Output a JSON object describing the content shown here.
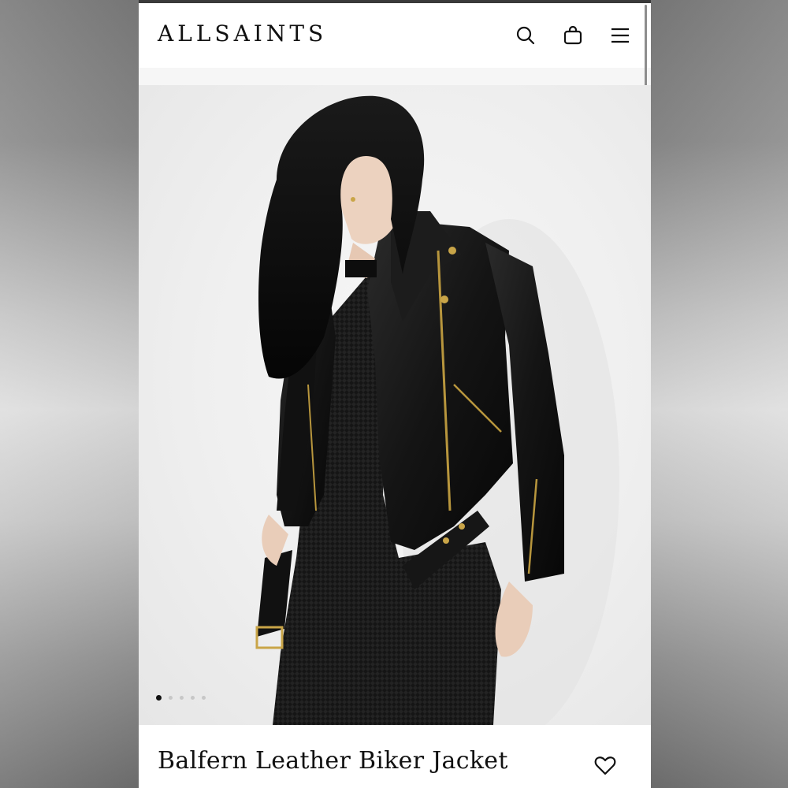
{
  "brand": {
    "logo_text": "ALLSAINTS"
  },
  "header": {
    "icons": [
      "search-icon",
      "shopping-bag-icon",
      "menu-icon"
    ]
  },
  "gallery": {
    "image_count": 5,
    "active_index": 0
  },
  "product": {
    "title": "Balfern Leather Biker Jacket",
    "wishlist_icon": "heart-icon"
  },
  "colors": {
    "text": "#111111",
    "background": "#ffffff",
    "inactive_dot": "#c7c7c7"
  }
}
